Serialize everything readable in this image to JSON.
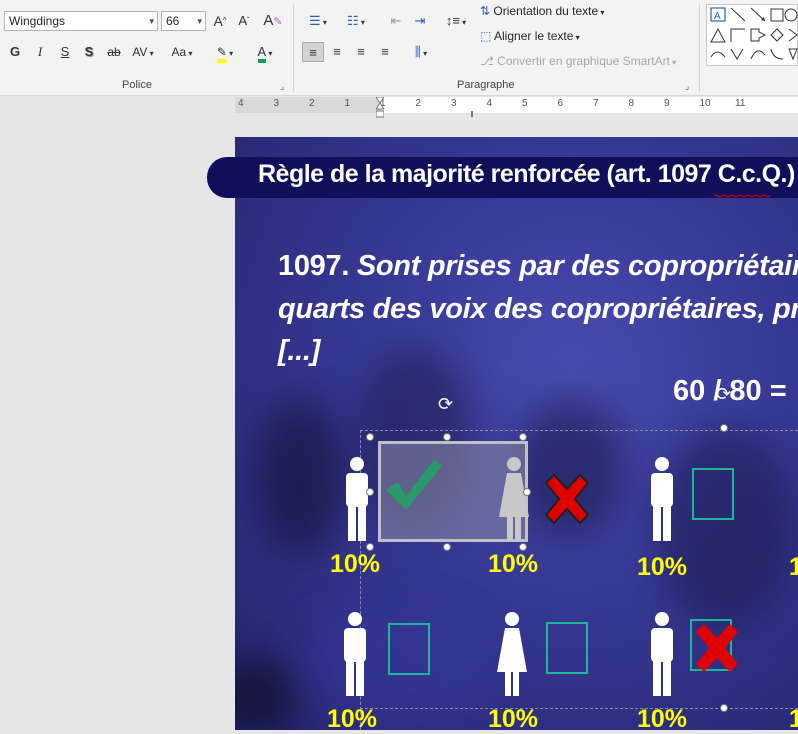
{
  "ribbon": {
    "font_name": "Wingdings",
    "font_size": "66",
    "grow_font": "A˄",
    "shrink_font": "A˅",
    "bold": "G",
    "italic": "I",
    "underline": "S",
    "shadow": "S",
    "strike": "ab",
    "spacing": "AV",
    "case": "Aa",
    "group_font": "Police",
    "group_paragraph": "Paragraphe",
    "text_direction": "Orientation du texte",
    "align_text": "Aligner le texte",
    "smartart": "Convertir en graphique SmartArt"
  },
  "ruler": {
    "numbers": [
      "4",
      "3",
      "2",
      "1",
      "1",
      "2",
      "3",
      "4",
      "5",
      "6",
      "7",
      "8",
      "9",
      "10",
      "11"
    ]
  },
  "slide": {
    "title": "Règle de la majorité renforcée (art. 1097 C.c.Q.)",
    "article_num": "1097.",
    "article_line1": "Sont prises par des copropriétaires",
    "article_line2": "quarts des voix des copropriétaires, pr",
    "article_line3": "[...]",
    "ratio": "60 / 80 =",
    "percent_labels": [
      "10%",
      "10%",
      "10%",
      "1",
      "10%",
      "10%",
      "10%",
      "1"
    ]
  },
  "colors": {
    "slide_bg": "#3a3c9a",
    "title_bar": "#10105a",
    "percent": "#ffff00",
    "checkbox": "#1fb59a",
    "cross": "#e00000",
    "check": "#2a9a6a"
  }
}
